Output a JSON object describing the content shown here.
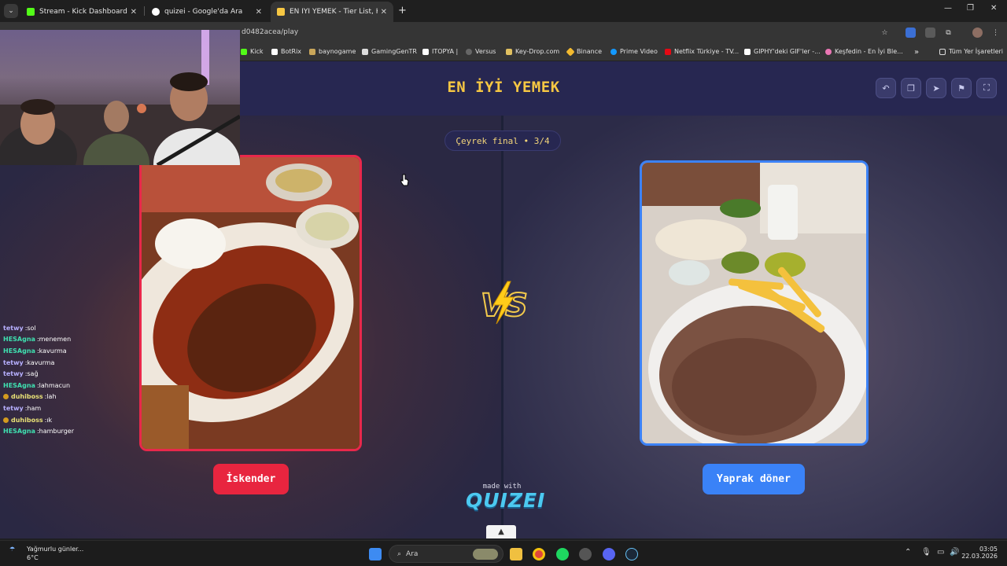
{
  "browser": {
    "tabs": [
      {
        "title": "Stream - Kick Dashboard",
        "active": false
      },
      {
        "title": "quizei - Google'da Ara",
        "active": false
      },
      {
        "title": "EN İYİ YEMEK - Tier List, Kör Sı",
        "active": true
      }
    ],
    "new_tab": "+",
    "window_controls": [
      "—",
      "❐",
      "✕"
    ],
    "url": "d0482acea/play",
    "bookmarks": [
      "Kick",
      "BotRix",
      "baynogame",
      "GamingGenTR",
      "ITOPYA |",
      "Versus",
      "Key-Drop.com",
      "Binance",
      "Prime Video",
      "Netflix Türkiye - TV...",
      "GIPHY'deki GIF'ler -...",
      "Keşfedin - En İyi Ble..."
    ],
    "bookmarks_more": "»",
    "all_bookmarks": "Tüm Yer İşaretleri"
  },
  "quiz": {
    "title": "EN İYİ YEMEK",
    "round": "Çeyrek final • 3/4",
    "left_option": "İskender",
    "right_option": "Yaprak döner",
    "vs": "VS",
    "made_with": "made with",
    "brand": "QUIZEI",
    "colors": {
      "left": "#e8253f",
      "right": "#3a82f7",
      "title": "#f6c743"
    }
  },
  "chat": [
    {
      "user": "tetwy",
      "message": "sol",
      "color": "#b7b0ff",
      "badge": false
    },
    {
      "user": "HESAgna",
      "message": "menemen",
      "color": "#3fe0b0",
      "badge": false
    },
    {
      "user": "HESAgna",
      "message": "kavurma",
      "color": "#3fe0b0",
      "badge": false
    },
    {
      "user": "tetwy",
      "message": "kavurma",
      "color": "#b7b0ff",
      "badge": false
    },
    {
      "user": "tetwy",
      "message": "sağ",
      "color": "#b7b0ff",
      "badge": false
    },
    {
      "user": "HESAgna",
      "message": "lahmacun",
      "color": "#3fe0b0",
      "badge": false
    },
    {
      "user": "duhiboss",
      "message": "lah",
      "color": "#e8e076",
      "badge": true
    },
    {
      "user": "tetwy",
      "message": "ham",
      "color": "#b7b0ff",
      "badge": false
    },
    {
      "user": "duhiboss",
      "message": "ık",
      "color": "#e8e076",
      "badge": true
    },
    {
      "user": "HESAgna",
      "message": "hamburger",
      "color": "#3fe0b0",
      "badge": false
    }
  ],
  "taskbar": {
    "weather_text": "Yağmurlu günler...",
    "temperature": "6°C",
    "search_placeholder": "Ara",
    "time": "03:05",
    "date": "22.03.2026"
  }
}
